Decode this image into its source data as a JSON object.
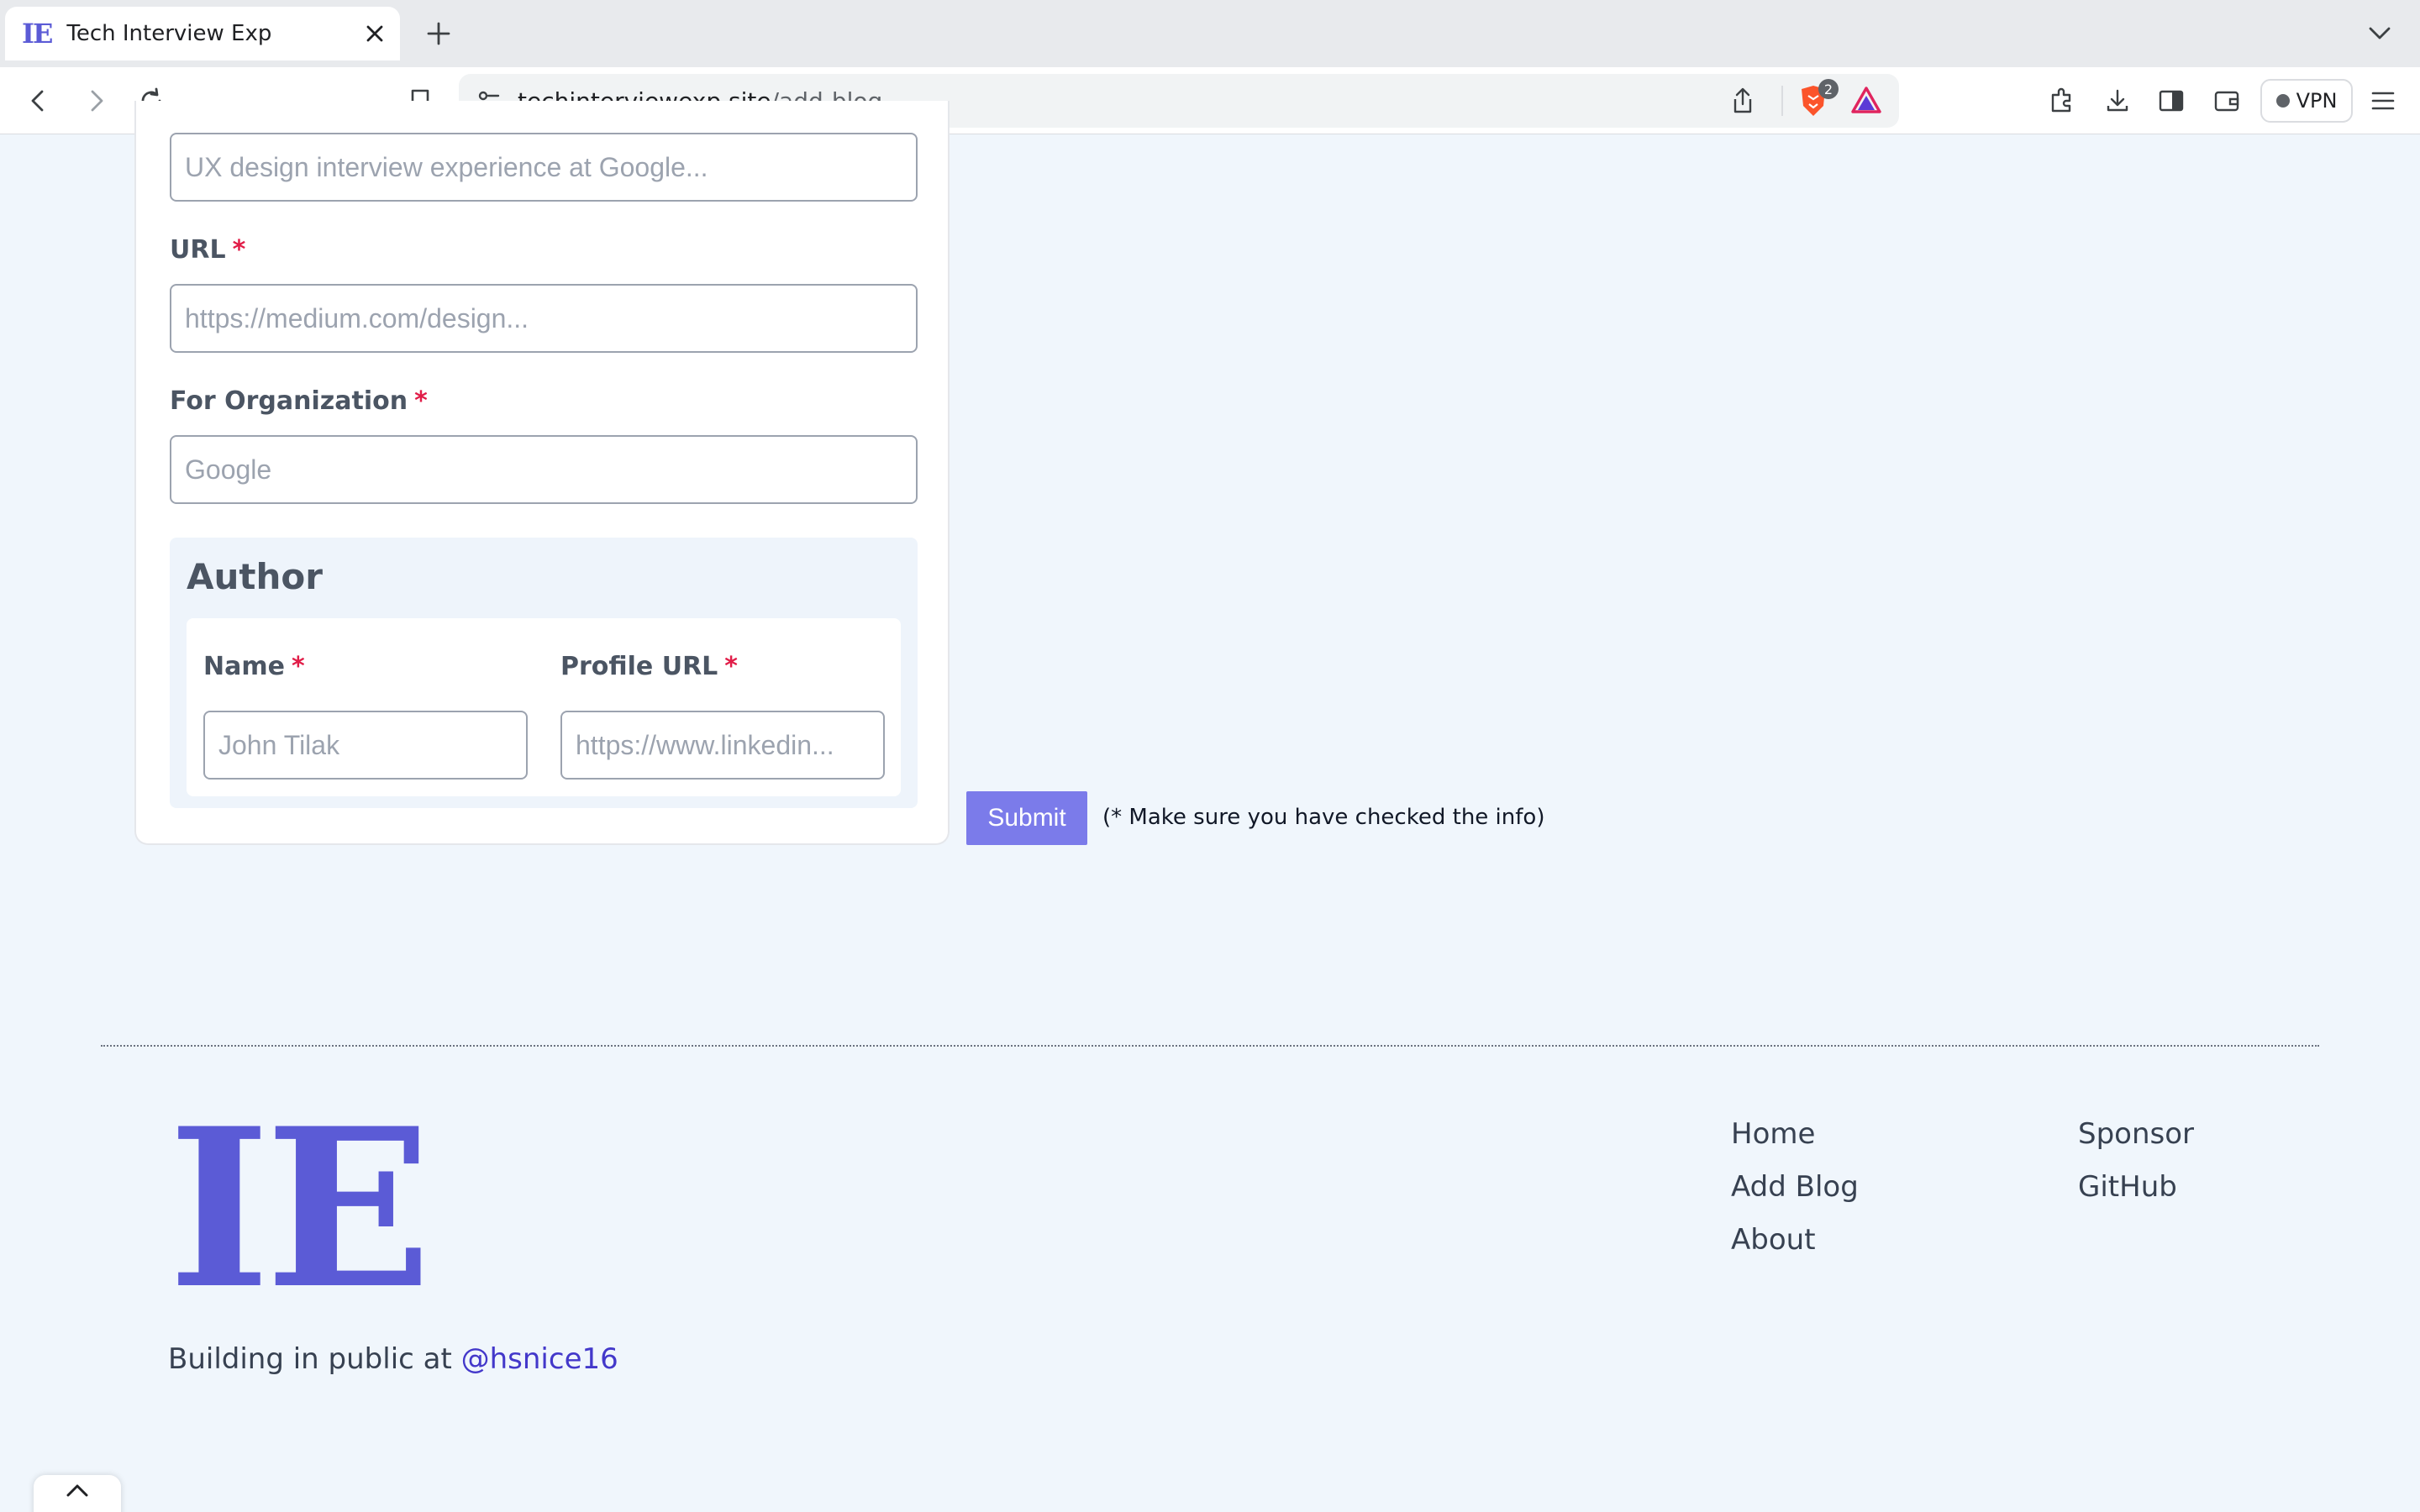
{
  "browser": {
    "tab_title": "Tech Interview Exp",
    "tab_favicon_text": "IE",
    "url_domain": "techinterviewexp.site",
    "url_path": "/add-blog",
    "shields_count": "2",
    "vpn_label": "VPN"
  },
  "form": {
    "title_placeholder": "UX design interview experience at Google...",
    "url_label": "URL",
    "url_placeholder": "https://medium.com/design...",
    "org_label": "For Organization",
    "org_placeholder": "Google",
    "required_mark": "*",
    "author": {
      "heading": "Author",
      "name_label": "Name",
      "name_placeholder": "John Tilak",
      "profile_label": "Profile URL",
      "profile_placeholder": "https://www.linkedin..."
    },
    "submit_label": "Submit",
    "submit_note": "(* Make sure you have checked the info)"
  },
  "footer": {
    "logo_text": "IE",
    "tagline": "Building in public at ",
    "handle": "@hsnice16",
    "links_col1": [
      "Home",
      "Add Blog",
      "About"
    ],
    "links_col2": [
      "Sponsor",
      "GitHub"
    ]
  },
  "colors": {
    "brand": "#5b5bd6",
    "submit": "#7b7bea",
    "required": "#e11d48",
    "page_bg": "#f0f6fc"
  }
}
